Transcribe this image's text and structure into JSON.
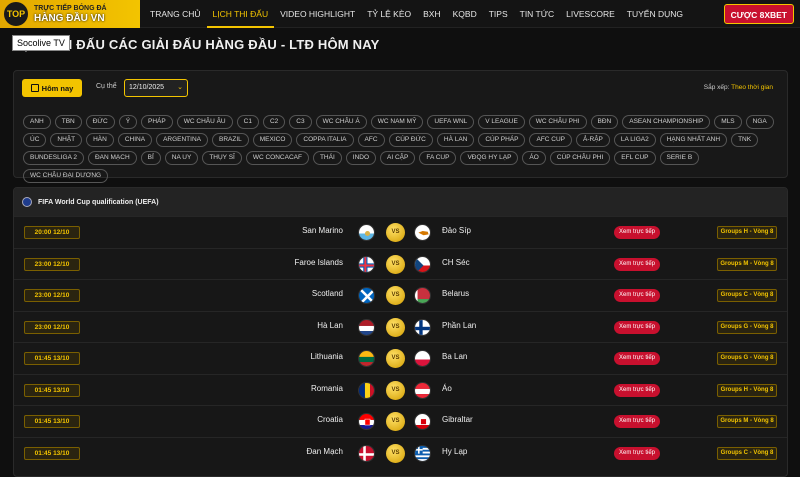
{
  "logo": {
    "badge": "TOP",
    "sub": "TRỰC TIẾP BÓNG ĐÁ",
    "main": "HÀNG ĐẦU VN"
  },
  "nav": [
    "TRANG CHỦ",
    "LỊCH THI ĐẤU",
    "VIDEO HIGHLIGHT",
    "TỶ LỆ KÈO",
    "BXH",
    "KQBD",
    "TIPS",
    "TIN TỨC",
    "LIVESCORE",
    "TUYỂN DỤNG"
  ],
  "cta": "CƯỢC 8XBET",
  "tooltip": "Socolive TV",
  "page_title": "LỊCH THI ĐẤU CÁC GIẢI ĐẤU HÀNG ĐẦU - LTĐ HÔM NAY",
  "filter": {
    "today_label": "Hôm nay",
    "date_label": "Cụ thể",
    "date_value": "12/10/2025",
    "sort_label": "Sắp xếp:",
    "sort_value": "Theo thời gian",
    "chips": [
      "ANH",
      "TBN",
      "ĐỨC",
      "Ý",
      "PHÁP",
      "WC CHÂU ÂU",
      "C1",
      "C2",
      "C3",
      "WC CHÂU Á",
      "WC NAM MỸ",
      "UEFA WNL",
      "V LEAGUE",
      "WC CHÂU PHI",
      "BĐN",
      "ASEAN CHAMPIONSHIP",
      "MLS",
      "NGA",
      "ÚC",
      "NHẬT",
      "HÀN",
      "CHINA",
      "ARGENTINA",
      "BRAZIL",
      "MEXICO",
      "COPPA ITALIA",
      "AFC",
      "CÚP ĐỨC",
      "HÀ LAN",
      "CÚP PHÁP",
      "AFC CUP",
      "Ả-RẬP",
      "LA LIGA2",
      "HẠNG NHẤT ANH",
      "TNK",
      "BUNDESLIGA 2",
      "ĐAN MẠCH",
      "BỈ",
      "NA UY",
      "THỤY SĨ",
      "WC CONCACAF",
      "THÁI",
      "INDO",
      "AI CẬP",
      "FA CUP",
      "VĐQG HY LẠP",
      "ÁO",
      "CÚP CHÂU PHI",
      "EFL CUP",
      "SERIE B",
      "WC CHÂU ĐẠI DƯƠNG"
    ]
  },
  "league": "FIFA World Cup qualification (UEFA)",
  "vs_label": "VS",
  "watch_label": "Xem trực tiếp",
  "matches": [
    {
      "time": "20:00 12/10",
      "home": "San Marino",
      "away": "Đảo Síp",
      "group": "Groups H - Vòng 8"
    },
    {
      "time": "23:00 12/10",
      "home": "Faroe Islands",
      "away": "CH Séc",
      "group": "Groups M - Vòng 8"
    },
    {
      "time": "23:00 12/10",
      "home": "Scotland",
      "away": "Belarus",
      "group": "Groups C - Vòng 8"
    },
    {
      "time": "23:00 12/10",
      "home": "Hà Lan",
      "away": "Phần Lan",
      "group": "Groups G - Vòng 8"
    },
    {
      "time": "01:45 13/10",
      "home": "Lithuania",
      "away": "Ba Lan",
      "group": "Groups G - Vòng 8"
    },
    {
      "time": "01:45 13/10",
      "home": "Romania",
      "away": "Áo",
      "group": "Groups H - Vòng 8"
    },
    {
      "time": "01:45 13/10",
      "home": "Croatia",
      "away": "Gibraltar",
      "group": "Groups M - Vòng 8"
    },
    {
      "time": "01:45 13/10",
      "home": "Đan Mạch",
      "away": "Hy Lạp",
      "group": "Groups C - Vòng 8"
    }
  ]
}
